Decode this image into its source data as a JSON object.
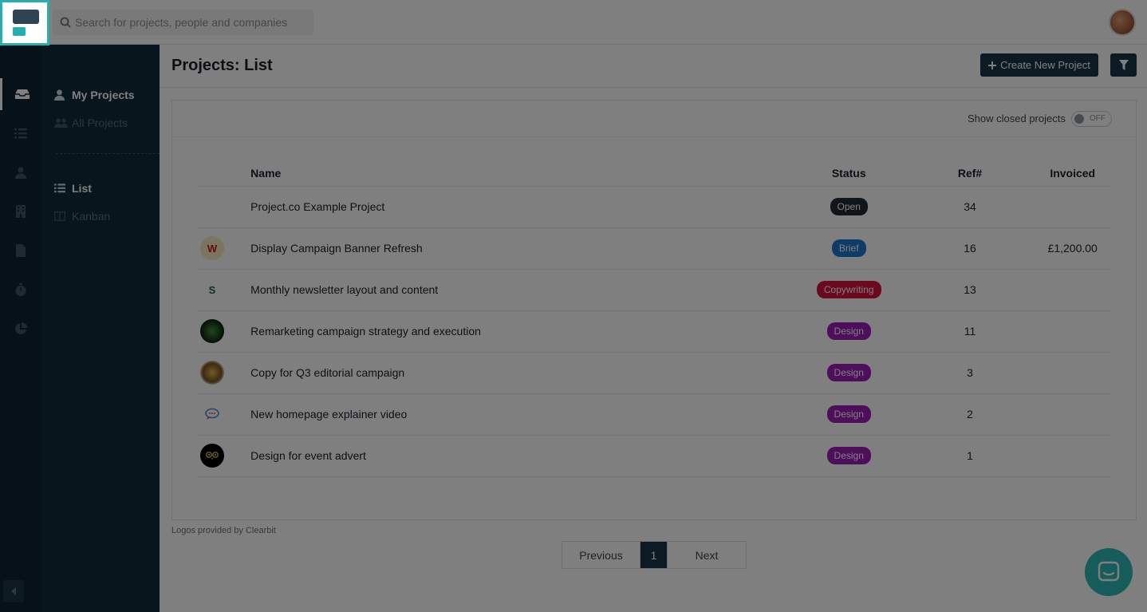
{
  "search": {
    "placeholder": "Search for projects, people and companies"
  },
  "sidebar": {
    "items": [
      {
        "label": "My Projects",
        "icon": "user-icon"
      },
      {
        "label": "All Projects",
        "icon": "users-icon"
      },
      {
        "label": "List",
        "icon": "list-icon"
      },
      {
        "label": "Kanban",
        "icon": "columns-icon"
      }
    ]
  },
  "header": {
    "title": "Projects: List",
    "create_label": "Create New Project"
  },
  "filters": {
    "show_closed_label": "Show closed projects",
    "toggle_state": "OFF"
  },
  "table": {
    "headers": {
      "name": "Name",
      "status": "Status",
      "ref": "Ref#",
      "invoiced": "Invoiced"
    },
    "rows": [
      {
        "name": "Project.co Example Project",
        "status": "Open",
        "status_color": "#222a33",
        "ref": "34",
        "invoiced": "",
        "logo": ""
      },
      {
        "name": "Display Campaign Banner Refresh",
        "status": "Brief",
        "status_color": "#1f77d0",
        "ref": "16",
        "invoiced": "£1,200.00",
        "logo": "W"
      },
      {
        "name": "Monthly newsletter layout and content",
        "status": "Copywriting",
        "status_color": "#d6133f",
        "ref": "13",
        "invoiced": "",
        "logo": "S"
      },
      {
        "name": "Remarketing campaign strategy and execution",
        "status": "Design",
        "status_color": "#9b1cb8",
        "ref": "11",
        "invoiced": "",
        "logo": ""
      },
      {
        "name": "Copy for Q3 editorial campaign",
        "status": "Design",
        "status_color": "#9b1cb8",
        "ref": "3",
        "invoiced": "",
        "logo": ""
      },
      {
        "name": "New homepage explainer video",
        "status": "Design",
        "status_color": "#9b1cb8",
        "ref": "2",
        "invoiced": "",
        "logo": ""
      },
      {
        "name": "Design for event advert",
        "status": "Design",
        "status_color": "#9b1cb8",
        "ref": "1",
        "invoiced": "",
        "logo": ""
      }
    ]
  },
  "footer": {
    "logos_note": "Logos provided by Clearbit"
  },
  "pagination": {
    "previous": "Previous",
    "current": "1",
    "next": "Next"
  },
  "colors": {
    "brand": "#27aeb0",
    "navy": "#163447",
    "rail": "#0c2333"
  }
}
